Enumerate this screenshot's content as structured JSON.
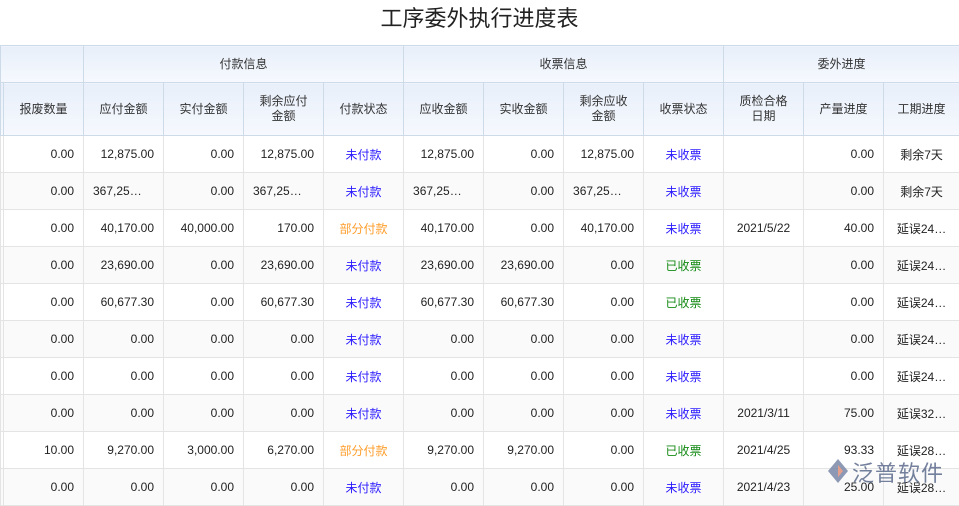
{
  "title": "工序委外执行进度表",
  "groups": [
    {
      "label": "",
      "span": 2
    },
    {
      "label": "付款信息",
      "span": 4
    },
    {
      "label": "收票信息",
      "span": 4
    },
    {
      "label": "委外进度",
      "span": 3
    }
  ],
  "columns": [
    "",
    "报废数量",
    "应付金额",
    "实付金额",
    "剩余应付金额",
    "付款状态",
    "应收金额",
    "实收金额",
    "剩余应收金额",
    "收票状态",
    "质检合格日期",
    "产量进度",
    "工期进度"
  ],
  "status_colors": {
    "未付款": "#2b1bff",
    "未收票": "#2b1bff",
    "部分付款": "#ff9d2a",
    "已收票": "#148a14"
  },
  "rows": [
    [
      "",
      "0.00",
      "12,875.00",
      "0.00",
      "12,875.00",
      "未付款",
      "12,875.00",
      "0.00",
      "12,875.00",
      "未收票",
      "",
      "0.00",
      "剩余7天"
    ],
    [
      "",
      "0.00",
      "367,25…",
      "0.00",
      "367,25…",
      "未付款",
      "367,25…",
      "0.00",
      "367,25…",
      "未收票",
      "",
      "0.00",
      "剩余7天"
    ],
    [
      "",
      "0.00",
      "40,170.00",
      "40,000.00",
      "170.00",
      "部分付款",
      "40,170.00",
      "0.00",
      "40,170.00",
      "未收票",
      "2021/5/22",
      "40.00",
      "延误24…"
    ],
    [
      "",
      "0.00",
      "23,690.00",
      "0.00",
      "23,690.00",
      "未付款",
      "23,690.00",
      "23,690.00",
      "0.00",
      "已收票",
      "",
      "0.00",
      "延误24…"
    ],
    [
      "",
      "0.00",
      "60,677.30",
      "0.00",
      "60,677.30",
      "未付款",
      "60,677.30",
      "60,677.30",
      "0.00",
      "已收票",
      "",
      "0.00",
      "延误24…"
    ],
    [
      "",
      "0.00",
      "0.00",
      "0.00",
      "0.00",
      "未付款",
      "0.00",
      "0.00",
      "0.00",
      "未收票",
      "",
      "0.00",
      "延误24…"
    ],
    [
      "",
      "0.00",
      "0.00",
      "0.00",
      "0.00",
      "未付款",
      "0.00",
      "0.00",
      "0.00",
      "未收票",
      "",
      "0.00",
      "延误24…"
    ],
    [
      "",
      "0.00",
      "0.00",
      "0.00",
      "0.00",
      "未付款",
      "0.00",
      "0.00",
      "0.00",
      "未收票",
      "2021/3/11",
      "75.00",
      "延误32…"
    ],
    [
      "",
      "10.00",
      "9,270.00",
      "3,000.00",
      "6,270.00",
      "部分付款",
      "9,270.00",
      "9,270.00",
      "0.00",
      "已收票",
      "2021/4/25",
      "93.33",
      "延误28…"
    ],
    [
      "",
      "0.00",
      "0.00",
      "0.00",
      "0.00",
      "未付款",
      "0.00",
      "0.00",
      "0.00",
      "未收票",
      "2021/4/23",
      "25.00",
      "延误28…"
    ]
  ],
  "logo": {
    "text": "泛普软件",
    "url": "www.fanpusoft.com"
  }
}
